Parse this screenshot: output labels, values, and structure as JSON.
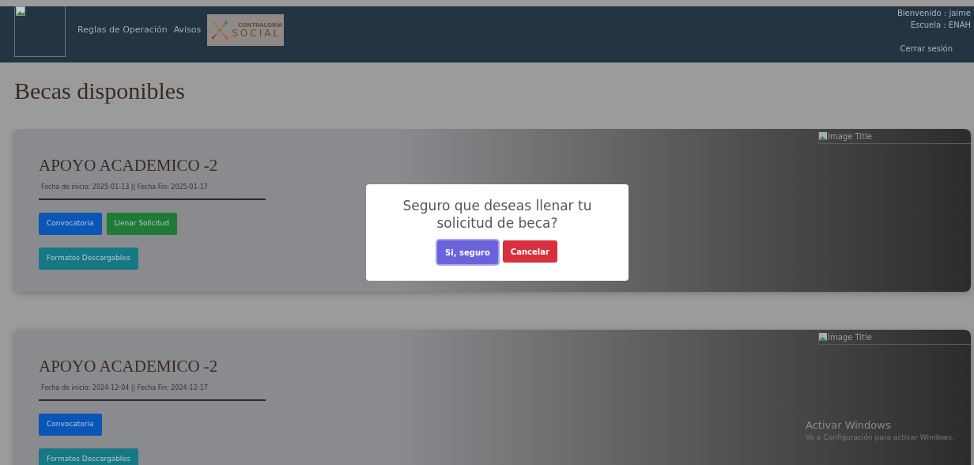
{
  "header": {
    "nav_links": [
      "Reglas de Operación",
      "Avisos"
    ],
    "logo": {
      "line_1": "CONTRALORÍA",
      "line_2": "SOCIAL"
    },
    "user": {
      "welcome": "Bienvenido : jaime",
      "school": "Escuela : ENAH",
      "logout": "Cerrar sesión"
    }
  },
  "page_title": "Becas disponibles",
  "cards": [
    {
      "title": "APOYO ACADEMICO -2",
      "dates": "Fecha de inicio: 2025-01-13 || Fecha Fin: 2025-01-17",
      "image_alt": "Image Title",
      "button_rows": [
        [
          {
            "label": "Convocatoria",
            "kind": "primary"
          },
          {
            "label": "Llenar Solicitud",
            "kind": "success"
          }
        ],
        [
          {
            "label": "Formatos Descargables",
            "kind": "info"
          }
        ]
      ]
    },
    {
      "title": "APOYO ACADEMICO -2",
      "dates": "Fecha de inicio: 2024-12-04 || Fecha Fin: 2024-12-17",
      "image_alt": "Image Title",
      "button_rows": [
        [
          {
            "label": "Convocatoria",
            "kind": "primary"
          }
        ],
        [
          {
            "label": "Formatos Descargables",
            "kind": "info"
          }
        ]
      ]
    }
  ],
  "modal": {
    "message": "Seguro que deseas llenar tu solicitud de beca?",
    "confirm": "Si, seguro",
    "cancel": "Cancelar"
  },
  "os_notice": {
    "title": "Activar Windows",
    "subtitle": "Ve a Configuración para activar Windows."
  }
}
